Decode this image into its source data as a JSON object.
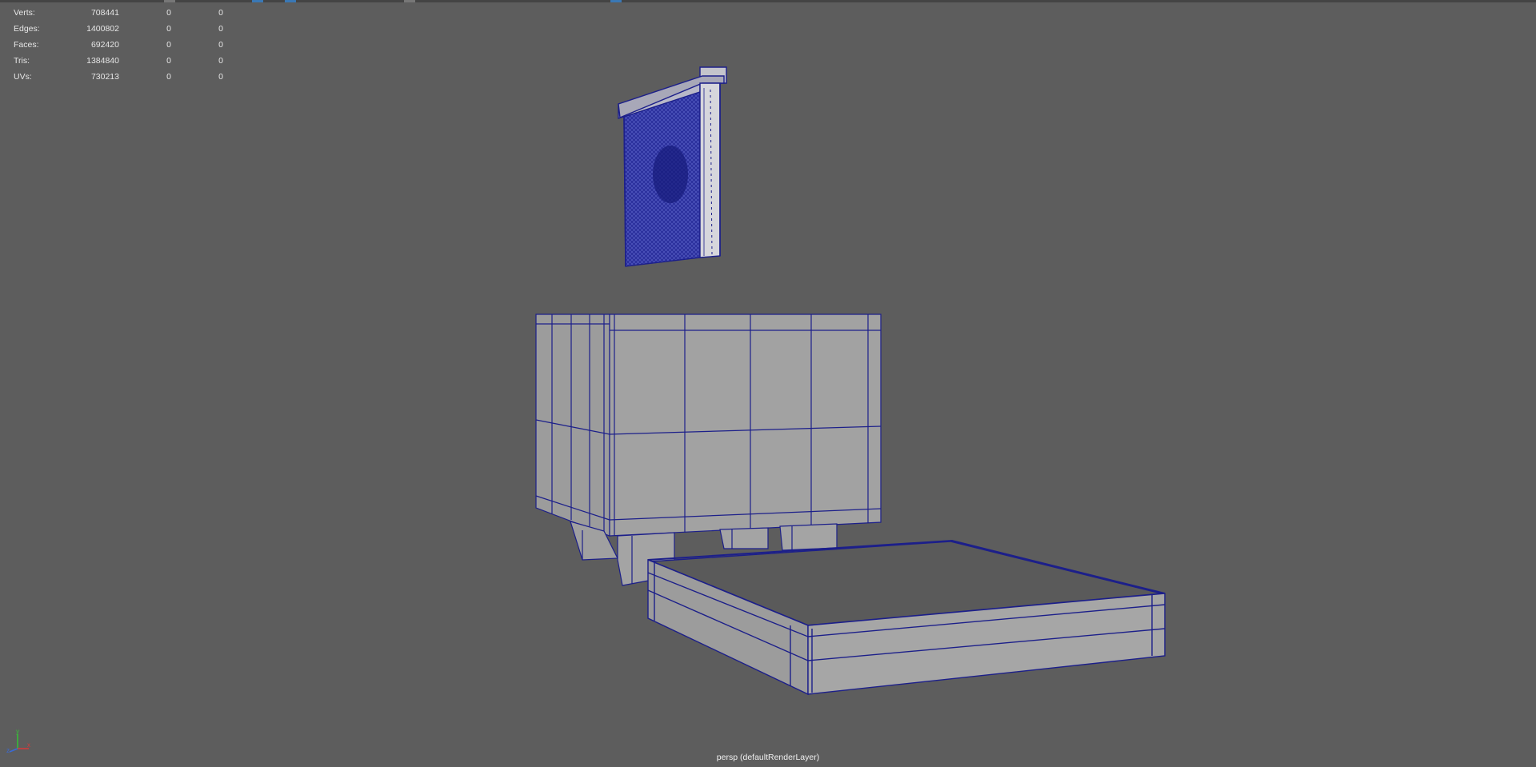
{
  "toolbar": {
    "icons": [
      "toolbar-icon",
      "toolbar-icon",
      "toolbar-icon",
      "toolbar-icon",
      "toolbar-icon"
    ]
  },
  "hud": {
    "rows": [
      {
        "label": "Verts:",
        "value": "708441",
        "a": "0",
        "b": "0"
      },
      {
        "label": "Edges:",
        "value": "1400802",
        "a": "0",
        "b": "0"
      },
      {
        "label": "Faces:",
        "value": "692420",
        "a": "0",
        "b": "0"
      },
      {
        "label": "Tris:",
        "value": "1384840",
        "a": "0",
        "b": "0"
      },
      {
        "label": "UVs:",
        "value": "730213",
        "a": "0",
        "b": "0"
      }
    ]
  },
  "viewport": {
    "camera_label": "persp (defaultRenderLayer)",
    "wire_color": "#1c1f8a",
    "face_color": "#9a9a9a",
    "axis": {
      "x": "x",
      "y": "y",
      "z": "z"
    },
    "objects": [
      "wall-shelf-model",
      "cabinet-model",
      "bed-frame-model"
    ]
  }
}
